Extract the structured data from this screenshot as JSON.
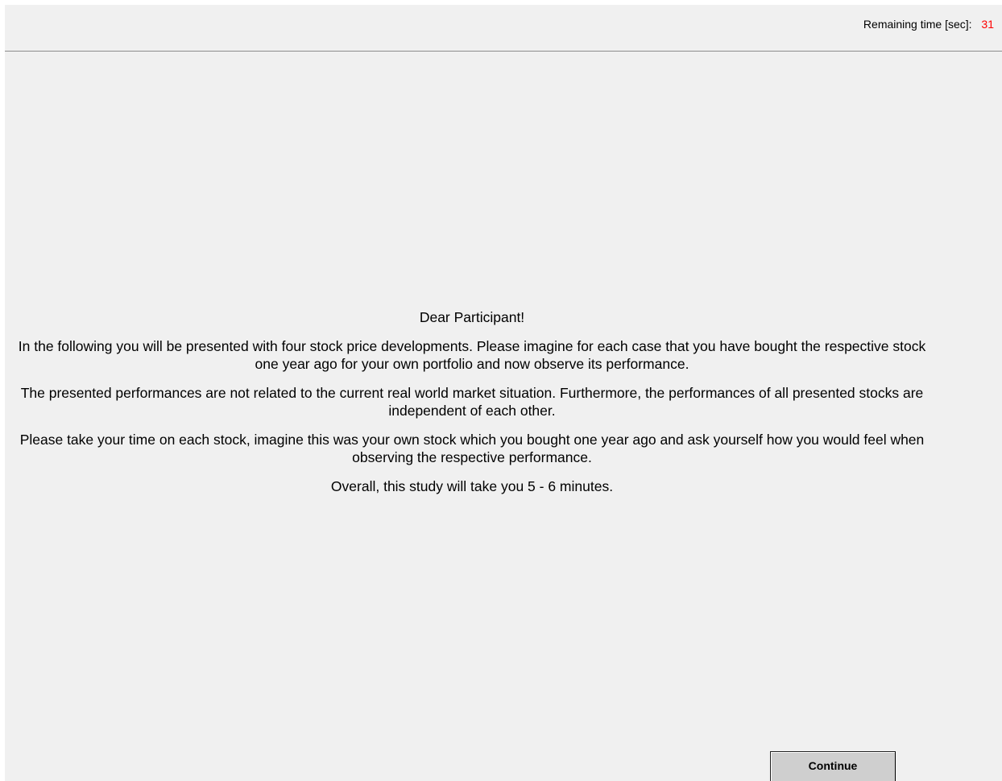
{
  "header": {
    "timer_label": "Remaining time [sec]:",
    "timer_value": "31",
    "timer_value_color": "#ff0000"
  },
  "content": {
    "greeting": "Dear Participant!",
    "paragraphs": [
      "In the following you will be presented with four stock price developments. Please imagine for each case that you have bought the respective stock one year ago for your own portfolio and now observe its performance.",
      "The presented performances are not related to the current real world market situation. Furthermore, the performances of all presented stocks are independent of each other.",
      "Please take your time on each stock, imagine this was your own stock which you bought one year ago and ask yourself how you would feel when observing the respective performance.",
      "Overall, this study will take you 5 - 6 minutes."
    ]
  },
  "footer": {
    "continue_label": "Continue"
  }
}
